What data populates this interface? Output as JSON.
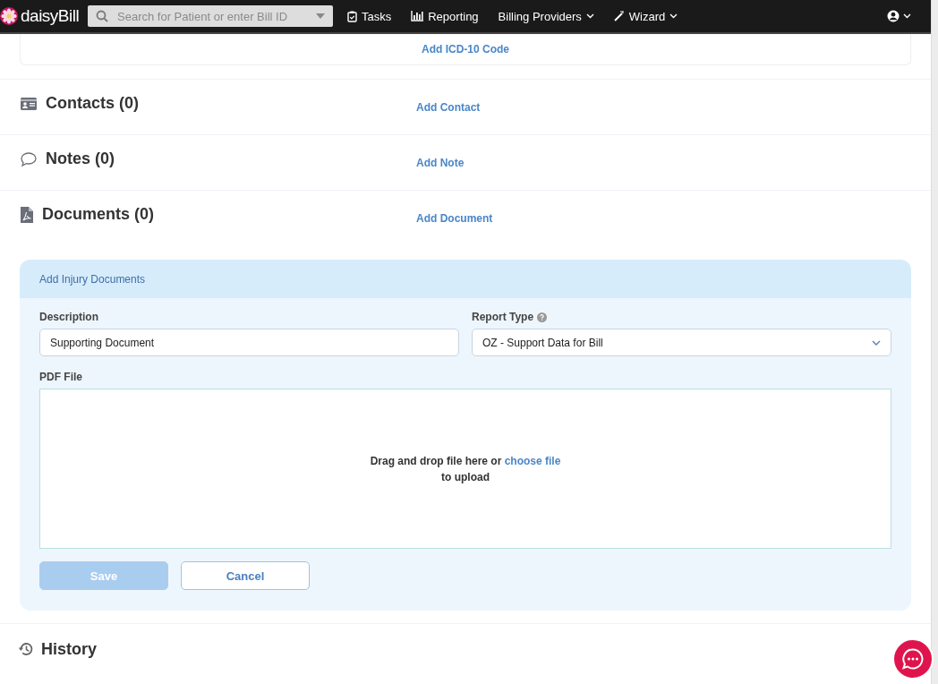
{
  "navbar": {
    "brand": "daisyBill",
    "search": {
      "placeholder": "Search for Patient or enter Bill ID"
    },
    "items": [
      {
        "label": "Tasks",
        "kind": "tasks",
        "dropdown": false
      },
      {
        "label": "Reporting",
        "kind": "reporting",
        "dropdown": false
      },
      {
        "label": "Billing Providers",
        "kind": "plain",
        "dropdown": true
      },
      {
        "label": "Wizard",
        "kind": "wizard",
        "dropdown": true
      }
    ]
  },
  "icd_card": {
    "link": "Add ICD-10 Code"
  },
  "sections": [
    {
      "kind": "contacts",
      "title": "Contacts (0)",
      "action": "Add Contact"
    },
    {
      "kind": "notes",
      "title": "Notes (0)",
      "action": "Add Note"
    },
    {
      "kind": "documents",
      "title": "Documents (0)",
      "action": "Add Document"
    }
  ],
  "document_form": {
    "title": "Add Injury Documents",
    "description": {
      "label": "Description",
      "value": "Supporting Document"
    },
    "report_type": {
      "label": "Report Type",
      "value": "OZ - Support Data for Bill"
    },
    "pdf_file": {
      "label": "PDF File",
      "prompt": "Drag and drop file here or",
      "link": "choose file",
      "suffix": "to upload"
    },
    "buttons": [
      {
        "label": "Save",
        "kind": "primary",
        "disabled": true
      },
      {
        "label": "Cancel",
        "kind": "secondary",
        "disabled": false
      }
    ]
  },
  "history": {
    "title": "History"
  }
}
